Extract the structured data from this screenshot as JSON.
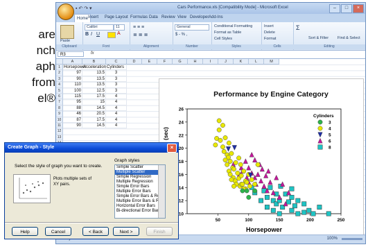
{
  "background_text": {
    "lines": [
      "are",
      "nch",
      "aph",
      "from",
      "el®"
    ]
  },
  "excel": {
    "window_title": "Cars Performance.xls [Compatibility Mode] - Microsoft Excel",
    "tabs": [
      "Home",
      "Insert",
      "Page Layout",
      "Formulas",
      "Data",
      "Review",
      "View",
      "Developer",
      "Add-Ins"
    ],
    "ribbon": {
      "paste_label": "Paste",
      "font_name": "Calibri",
      "font_size": "11",
      "number_format": "General",
      "conditional_formatting": "Conditional Formatting",
      "format_as_table": "Format as Table",
      "cell_styles": "Cell Styles",
      "insert": "Insert",
      "delete": "Delete",
      "format": "Format",
      "sort_filter": "Sort & Filter",
      "find_select": "Find & Select",
      "groups": [
        "Clipboard",
        "Font",
        "Alignment",
        "Number",
        "Styles",
        "Cells",
        "Editing"
      ]
    },
    "name_box": "R3",
    "fx_label": "fx",
    "columns": [
      "A",
      "B",
      "C",
      "D",
      "E",
      "F",
      "G",
      "H",
      "I",
      "J",
      "K",
      "L",
      "M"
    ],
    "row_numbers": [
      "1",
      "2",
      "3",
      "4",
      "5",
      "6",
      "7",
      "8",
      "9",
      "10",
      "11",
      "12",
      "13",
      "14",
      "15"
    ],
    "headers": [
      "Horsepower",
      "Acceleration",
      "Cylinders"
    ],
    "rows": [
      [
        "97",
        "13.5",
        "3"
      ],
      [
        "90",
        "13.5",
        "3"
      ],
      [
        "110",
        "13.5",
        "3"
      ],
      [
        "100",
        "12.5",
        "3"
      ],
      [
        "115",
        "17.5",
        "4"
      ],
      [
        "95",
        "15",
        "4"
      ],
      [
        "88",
        "14.5",
        "4"
      ],
      [
        "46",
        "20.5",
        "4"
      ],
      [
        "87",
        "17.5",
        "4"
      ],
      [
        "90",
        "14.5",
        "4"
      ]
    ],
    "status": "Ready",
    "zoom": "100%"
  },
  "chart_data": {
    "type": "scatter",
    "title": "Performance by Engine Category",
    "xlabel": "Horsepower",
    "ylabel": "(sec)",
    "xlim": [
      0,
      250
    ],
    "ylim": [
      0,
      26
    ],
    "x_ticks": [
      "50",
      "100",
      "150",
      "200",
      "250"
    ],
    "y_ticks": [
      "26",
      "24",
      "22",
      "20",
      "18",
      "16",
      "14",
      "12",
      "10"
    ],
    "legend_title": "Cylinders",
    "legend_position": "top-right",
    "series": [
      {
        "name": "3",
        "marker": "circle",
        "color": "#2db34a",
        "points": [
          [
            97,
            13.5
          ],
          [
            90,
            13.5
          ],
          [
            110,
            13.5
          ],
          [
            100,
            12.5
          ]
        ]
      },
      {
        "name": "4",
        "marker": "circle",
        "color": "#e8e800",
        "points": [
          [
            46,
            20.5
          ],
          [
            48,
            21.5
          ],
          [
            52,
            24.2
          ],
          [
            52,
            22.8
          ],
          [
            54,
            21.2
          ],
          [
            58,
            20.2
          ],
          [
            60,
            19.5
          ],
          [
            62,
            21.6
          ],
          [
            65,
            19
          ],
          [
            65,
            17.5
          ],
          [
            67,
            18.6
          ],
          [
            68,
            16.5
          ],
          [
            70,
            18
          ],
          [
            70,
            16
          ],
          [
            72,
            19.2
          ],
          [
            74,
            17
          ],
          [
            75,
            15.5
          ],
          [
            76,
            16.8
          ],
          [
            78,
            15
          ],
          [
            79,
            17.8
          ],
          [
            80,
            14.5
          ],
          [
            82,
            16.2
          ],
          [
            84,
            15.4
          ],
          [
            86,
            14.2
          ],
          [
            87,
            17.5
          ],
          [
            88,
            14.5
          ],
          [
            88,
            15.8
          ],
          [
            90,
            14.5
          ],
          [
            92,
            16.5
          ],
          [
            95,
            15
          ],
          [
            95,
            13.8
          ],
          [
            97,
            14.8
          ],
          [
            100,
            16
          ],
          [
            102,
            14.2
          ],
          [
            105,
            15.2
          ],
          [
            110,
            14.5
          ],
          [
            115,
            17.5
          ],
          [
            58,
            23.5
          ],
          [
            62,
            18.2
          ],
          [
            68,
            20.8
          ],
          [
            72,
            15.2
          ],
          [
            76,
            14.2
          ],
          [
            84,
            18.5
          ],
          [
            92,
            13.8
          ]
        ]
      },
      {
        "name": "5",
        "marker": "triangle-down",
        "color": "#1f2fa8",
        "points": [
          [
            67,
            19.9
          ],
          [
            77,
            20.1
          ],
          [
            103,
            15.9
          ]
        ]
      },
      {
        "name": "6",
        "marker": "triangle",
        "color": "#c4169a",
        "points": [
          [
            75,
            17.5
          ],
          [
            85,
            16
          ],
          [
            88,
            17
          ],
          [
            90,
            16.5
          ],
          [
            95,
            18
          ],
          [
            97,
            15.5
          ],
          [
            100,
            14.8
          ],
          [
            100,
            17
          ],
          [
            105,
            16.2
          ],
          [
            105,
            19
          ],
          [
            110,
            15.5
          ],
          [
            110,
            18.2
          ],
          [
            112,
            14.5
          ],
          [
            115,
            16
          ],
          [
            118,
            17.5
          ],
          [
            120,
            15
          ],
          [
            122,
            16.8
          ],
          [
            125,
            14.2
          ],
          [
            128,
            15.8
          ],
          [
            130,
            13.5
          ],
          [
            132,
            16.5
          ],
          [
            135,
            14.8
          ],
          [
            140,
            13.2
          ],
          [
            145,
            15.5
          ],
          [
            150,
            12.5
          ],
          [
            155,
            14.5
          ],
          [
            160,
            11.5
          ],
          [
            165,
            13.2
          ]
        ]
      },
      {
        "name": "8",
        "marker": "square",
        "color": "#1fc3c3",
        "points": [
          [
            105,
            14
          ],
          [
            110,
            13.2
          ],
          [
            120,
            12
          ],
          [
            125,
            13.5
          ],
          [
            130,
            12.5
          ],
          [
            130,
            11
          ],
          [
            135,
            14
          ],
          [
            140,
            12
          ],
          [
            140,
            10.5
          ],
          [
            145,
            13
          ],
          [
            145,
            11.5
          ],
          [
            150,
            12
          ],
          [
            150,
            10
          ],
          [
            152,
            14.2
          ],
          [
            155,
            11
          ],
          [
            160,
            13
          ],
          [
            160,
            9.5
          ],
          [
            165,
            11.8
          ],
          [
            170,
            10.5
          ],
          [
            170,
            12.5
          ],
          [
            175,
            9.2
          ],
          [
            175,
            11.2
          ],
          [
            180,
            10
          ],
          [
            180,
            12
          ],
          [
            185,
            8.5
          ],
          [
            190,
            10.2
          ],
          [
            190,
            11.5
          ],
          [
            195,
            9
          ],
          [
            198,
            10.5
          ],
          [
            200,
            8.5
          ],
          [
            205,
            10
          ],
          [
            210,
            9.2
          ],
          [
            215,
            11
          ],
          [
            220,
            8
          ],
          [
            225,
            8.8
          ],
          [
            230,
            10
          ],
          [
            135,
            9.5
          ],
          [
            150,
            8.5
          ],
          [
            165,
            8.8
          ],
          [
            170,
            13.8
          ]
        ]
      }
    ]
  },
  "dialog": {
    "title": "Create Graph - Style",
    "prompt": "Select the style of graph you want to create.",
    "description": "Plots multiple sets of XY pairs.",
    "graph_styles_label": "Graph styles",
    "graph_styles": [
      "Simple Scatter",
      "Multiple Scatter",
      "Simple Regression",
      "Multiple Regression",
      "Simple Error Bars",
      "Multiple Error Bars",
      "Simple Error Bars & Reg",
      "Multiple Error Bars & Reg",
      "Horizontal Error Bars",
      "Bi-directional Error Bars"
    ],
    "selected_style": "Multiple Scatter",
    "buttons": {
      "help": "Help",
      "cancel": "Cancel",
      "back": "< Back",
      "next": "Next >",
      "finish": "Finish"
    }
  }
}
